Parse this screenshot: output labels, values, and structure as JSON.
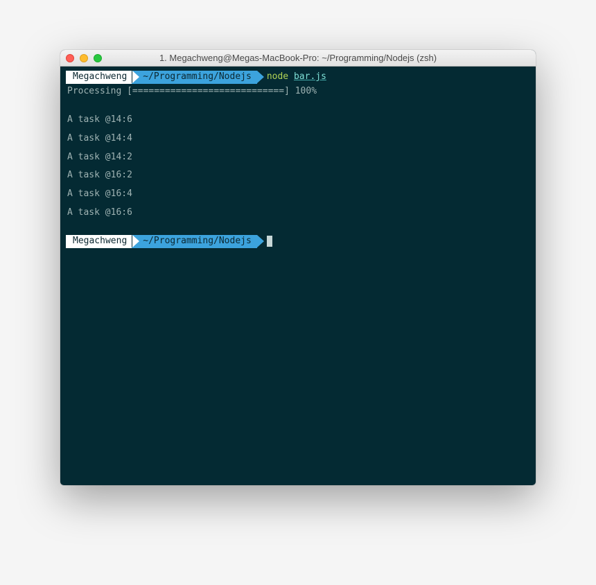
{
  "window": {
    "title": "1. Megachweng@Megas-MacBook-Pro: ~/Programming/Nodejs (zsh)"
  },
  "colors": {
    "close": "#ff5f57",
    "minimize": "#febc2e",
    "zoom": "#28c840",
    "terminal_bg": "#042a33",
    "prompt_user_bg": "#ffffff",
    "prompt_path_bg": "#3ca3dd"
  },
  "prompt": {
    "user": "Megachweng",
    "path": "~/Programming/Nodejs"
  },
  "command": {
    "bin": "node",
    "arg": "bar.js"
  },
  "output": {
    "progress_line": "Processing [============================] 100%",
    "tasks": [
      "A task @14:6",
      "A task @14:4",
      "A task @14:2",
      "A task @16:2",
      "A task @16:4",
      "A task @16:6"
    ]
  }
}
